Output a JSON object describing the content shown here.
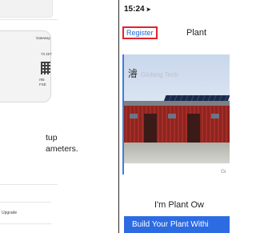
{
  "left_panel": {
    "card": {
      "label": "Gateway",
      "id_fragment": "73 207",
      "code_line1": "r95",
      "code_line2": "FSE"
    },
    "text_line1": "tup",
    "text_line2": "ameters.",
    "upgrade_label": "Upgrade"
  },
  "phone": {
    "status_time": "15:24",
    "status_arrow": "➤",
    "register_label": "Register",
    "nav_title": "Plant",
    "hero_logo_mark": "濬",
    "hero_logo_text": "Ginlong Tech",
    "partial_text": "Gi",
    "heading": "I'm Plant Ow",
    "cta_label": "Build Your Plant Withi"
  }
}
